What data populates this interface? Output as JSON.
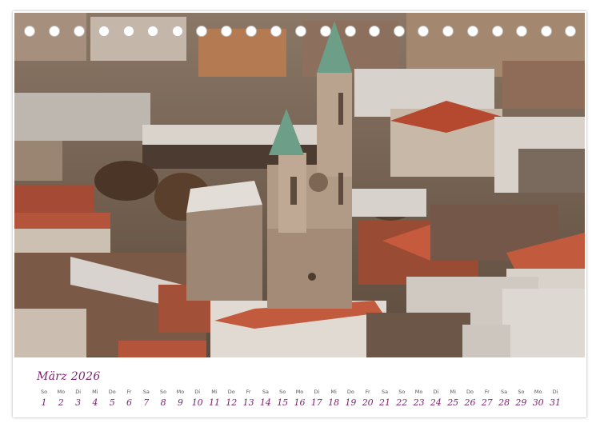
{
  "calendar": {
    "month_title": "März 2026",
    "days": [
      {
        "dow": "So",
        "num": "1"
      },
      {
        "dow": "Mo",
        "num": "2"
      },
      {
        "dow": "Di",
        "num": "3"
      },
      {
        "dow": "Mi",
        "num": "4"
      },
      {
        "dow": "Do",
        "num": "5"
      },
      {
        "dow": "Fr",
        "num": "6"
      },
      {
        "dow": "Sa",
        "num": "7"
      },
      {
        "dow": "So",
        "num": "8"
      },
      {
        "dow": "Mo",
        "num": "9"
      },
      {
        "dow": "Di",
        "num": "10"
      },
      {
        "dow": "Mi",
        "num": "11"
      },
      {
        "dow": "Do",
        "num": "12"
      },
      {
        "dow": "Fr",
        "num": "13"
      },
      {
        "dow": "Sa",
        "num": "14"
      },
      {
        "dow": "So",
        "num": "15"
      },
      {
        "dow": "Mo",
        "num": "16"
      },
      {
        "dow": "Di",
        "num": "17"
      },
      {
        "dow": "Mi",
        "num": "18"
      },
      {
        "dow": "Do",
        "num": "19"
      },
      {
        "dow": "Fr",
        "num": "20"
      },
      {
        "dow": "Sa",
        "num": "21"
      },
      {
        "dow": "So",
        "num": "22"
      },
      {
        "dow": "Mo",
        "num": "23"
      },
      {
        "dow": "Di",
        "num": "24"
      },
      {
        "dow": "Mi",
        "num": "25"
      },
      {
        "dow": "Do",
        "num": "26"
      },
      {
        "dow": "Fr",
        "num": "27"
      },
      {
        "dow": "Sa",
        "num": "28"
      },
      {
        "dow": "So",
        "num": "29"
      },
      {
        "dow": "Mo",
        "num": "30"
      },
      {
        "dow": "Di",
        "num": "31"
      }
    ]
  }
}
